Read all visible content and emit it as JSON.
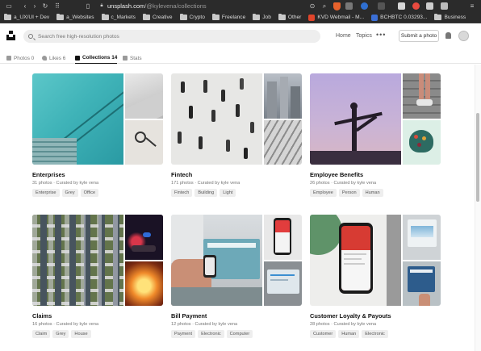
{
  "browser": {
    "url_domain": "unsplash.com",
    "url_path": "/@kylevena/collections"
  },
  "bookmarks": [
    {
      "label": "a_UX/UI + Dev",
      "type": "folder"
    },
    {
      "label": "a_Websites",
      "type": "folder"
    },
    {
      "label": "c_Markets",
      "type": "folder"
    },
    {
      "label": "Creative",
      "type": "folder"
    },
    {
      "label": "Crypto",
      "type": "folder"
    },
    {
      "label": "Freelance",
      "type": "folder"
    },
    {
      "label": "Job",
      "type": "folder"
    },
    {
      "label": "Other",
      "type": "folder"
    },
    {
      "label": "KVD Webmail - M...",
      "type": "site",
      "color": "#e0452b"
    },
    {
      "label": "BCHBTC 0.03293...",
      "type": "site",
      "color": "#3b6fd6"
    },
    {
      "label": "Business",
      "type": "folder"
    }
  ],
  "header": {
    "search_placeholder": "Search free high-resolution photos",
    "nav_home": "Home",
    "nav_topics": "Topics",
    "more": "•••",
    "submit_label": "Submit a photo"
  },
  "tabs": [
    {
      "label": "Photos 0",
      "icon": "image-icon"
    },
    {
      "label": "Likes 6",
      "icon": "heart-icon"
    },
    {
      "label": "Collections 14",
      "icon": "collections-icon",
      "active": true
    },
    {
      "label": "Stats",
      "icon": "chart-icon"
    }
  ],
  "collections": [
    {
      "title": "Enterprises",
      "meta": "31 photos · Curated by kyle vena",
      "tags": [
        "Enterprise",
        "Grey",
        "Office"
      ]
    },
    {
      "title": "Fintech",
      "meta": "171 photos · Curated by kyle vena",
      "tags": [
        "Fintech",
        "Building",
        "Light"
      ]
    },
    {
      "title": "Employee Benefits",
      "meta": "26 photos · Curated by kyle vena",
      "tags": [
        "Employee",
        "Person",
        "Human"
      ]
    },
    {
      "title": "Claims",
      "meta": "16 photos · Curated by kyle vena",
      "tags": [
        "Claim",
        "Grey",
        "House"
      ]
    },
    {
      "title": "Bill Payment",
      "meta": "12 photos · Curated by kyle vena",
      "tags": [
        "Payment",
        "Electronic",
        "Computer"
      ]
    },
    {
      "title": "Customer Loyalty & Payouts",
      "meta": "28 photos · Curated by kyle vena",
      "tags": [
        "Customer",
        "Human",
        "Electronic"
      ]
    }
  ]
}
